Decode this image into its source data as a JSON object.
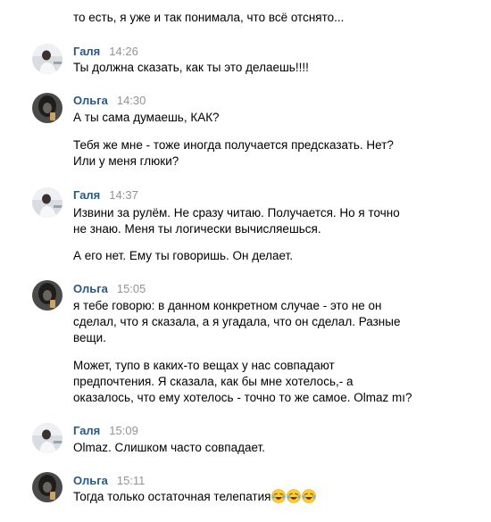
{
  "messages": [
    {
      "author": "",
      "time": "",
      "lines": [
        "то есть, я уже и так понимала, что всё отснято..."
      ]
    },
    {
      "author": "Галя",
      "time": "14:26",
      "lines": [
        "Ты должна сказать, как ты это делаешь!!!!"
      ]
    },
    {
      "author": "Ольга",
      "time": "14:30",
      "lines": [
        "А ты сама думаешь, КАК?",
        "Тебя же мне - тоже иногда получается предсказать. Нет?",
        "Или у меня глюки?"
      ]
    },
    {
      "author": "Галя",
      "time": "14:37",
      "lines": [
        "Извини за рулём. Не сразу читаю. Получается. Но я точно",
        "не знаю. Меня ты логически вычисляешься.",
        "А его нет. Ему ты говоришь. Он делает."
      ]
    },
    {
      "author": "Ольга",
      "time": "15:05",
      "lines": [
        "я тебе говорю: в данном конкретном случае - это не он",
        "сделал, что я сказала, а я угадала, что он сделал. Разные",
        "вещи.",
        "Может, тупо в каких-то вещах у нас совпадают",
        "предпочтения. Я сказала, как бы мне хотелось,- а",
        "оказалось, что ему хотелось - точно то же самое. Olmaz mı?"
      ]
    },
    {
      "author": "Галя",
      "time": "15:09",
      "lines": [
        "Olmaz. Слишком часто совпадает."
      ]
    },
    {
      "author": "Ольга",
      "time": "15:11",
      "lines": [
        "Тогда только остаточная телепатия"
      ]
    }
  ],
  "icons": {
    "avatar_galya": "avatar-galya",
    "avatar_olga": "avatar-olga",
    "laughing_emoji": "face-with-tears-of-joy-icon"
  },
  "colors": {
    "author_name": "#2a5885",
    "timestamp": "#939393",
    "text": "#000000",
    "background": "#ffffff"
  }
}
